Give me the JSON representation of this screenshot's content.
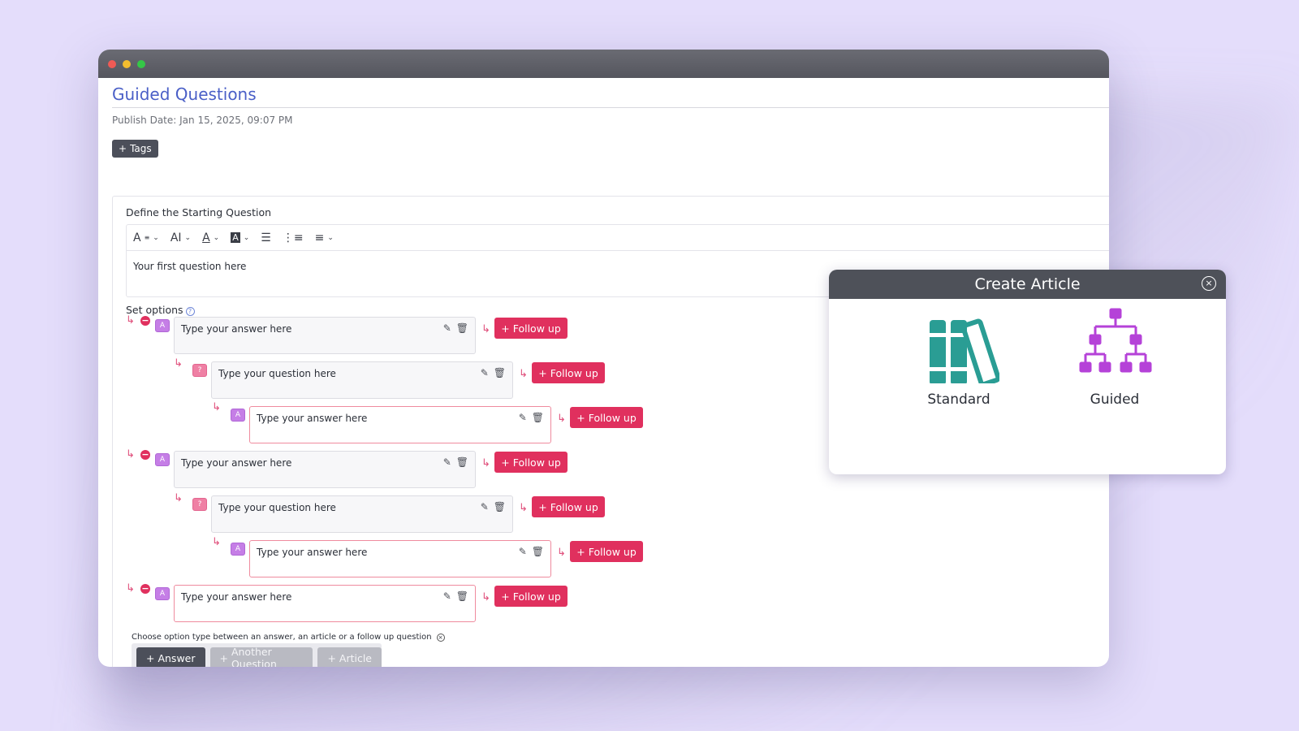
{
  "page": {
    "title": "Guided Questions",
    "publish_date": "Publish Date: Jan 15, 2025, 09:07 PM",
    "tags_label": "Tags"
  },
  "editor": {
    "label": "Define the Starting Question",
    "content": "Your first question here",
    "toolbar": [
      "font-style-icon",
      "font-size-icon",
      "text-color-icon",
      "highlight-icon",
      "bullet-list-icon",
      "numbered-list-icon",
      "align-icon"
    ]
  },
  "options": {
    "label": "Set options",
    "follow_up_label": "Follow up",
    "answer_placeholder": "Type your answer here",
    "question_placeholder": "Type your question here"
  },
  "choose": {
    "note": "Choose option type between an answer, an article or a follow up question",
    "answer": "Answer",
    "another_question": "Another Question",
    "article": "Article"
  },
  "modal": {
    "title": "Create Article",
    "standard": "Standard",
    "guided": "Guided"
  },
  "colors": {
    "accent": "#e0305e",
    "title_blue": "#4a5fc7",
    "teal": "#2a9d94",
    "purple": "#b542d8"
  }
}
